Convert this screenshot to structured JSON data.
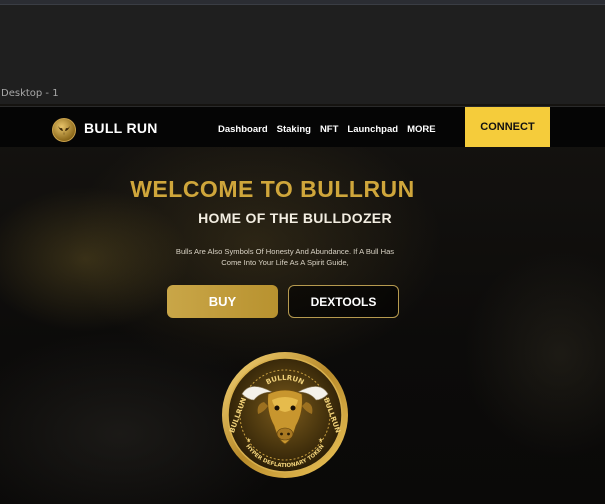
{
  "editor": {
    "frame_label": "Desktop - 1"
  },
  "nav": {
    "brand": "BULL RUN",
    "logo_icon": "bull-head-icon",
    "links": [
      "Dashboard",
      "Staking",
      "NFT",
      "Launchpad",
      "MORE"
    ],
    "connect_label": "CONNECT"
  },
  "hero": {
    "title": "WELCOME TO BULLRUN",
    "subtitle": "HOME OF THE BULLDOZER",
    "description": "Bulls  Are Also Symbols Of Honesty And Abundance. If A Bull Has Come Into Your Life As A Spirit Guide,",
    "buy_label": "BUY",
    "dextools_label": "DEXTOOLS"
  },
  "coin": {
    "top_text": "BULLRUN",
    "left_text": "BULLRUN",
    "right_text": "BULLRUN",
    "bottom_text": "HYPER DEFLATIONARY TOKEN",
    "image": "bull-coin-emblem"
  },
  "colors": {
    "accent_gold": "#cfa63b",
    "connect_yellow": "#f5cc3b",
    "nav_bg": "#050505",
    "page_bg": "#0b0a09"
  }
}
